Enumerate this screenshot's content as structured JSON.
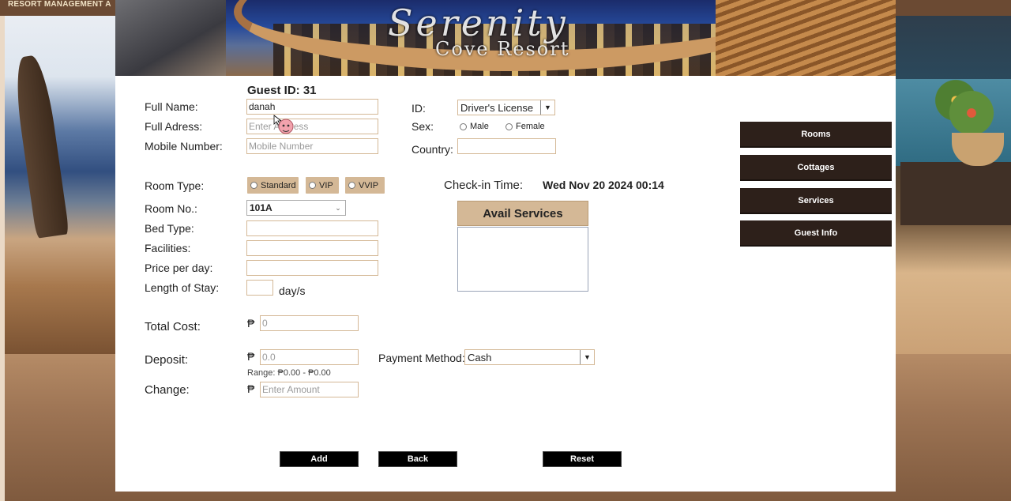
{
  "background": {
    "topbar_text": "RESORT MANAGEMENT    A"
  },
  "banner": {
    "logo_line1": "Serenity",
    "logo_line2": "Cove Resort"
  },
  "form": {
    "guest_id_label": "Guest ID: 31",
    "full_name_label": "Full Name:",
    "full_name_value": "danah",
    "full_address_label": "Full Adress:",
    "full_address_placeholder": "Enter Address",
    "mobile_label": "Mobile Number:",
    "mobile_placeholder": "Mobile Number",
    "id_label": "ID:",
    "id_select_value": "Driver's License",
    "sex_label": "Sex:",
    "sex_options": [
      "Male",
      "Female"
    ],
    "country_label": "Country:",
    "country_value": "",
    "room_type_label": "Room Type:",
    "room_type_options": [
      "Standard",
      "VIP",
      "VVIP"
    ],
    "checkin_label": "Check-in Time:",
    "checkin_value": "Wed Nov 20 2024 00:14",
    "room_no_label": "Room No.:",
    "room_no_value": "101A",
    "bed_type_label": "Bed Type:",
    "facilities_label": "Facilities:",
    "price_label": "Price per day:",
    "length_label": "Length of Stay:",
    "length_unit": "day/s",
    "total_cost_label": "Total Cost:",
    "currency_symbol": "₱",
    "total_cost_placeholder": "0",
    "deposit_label": "Deposit:",
    "deposit_placeholder": "0.0",
    "deposit_range": "Range: ₱0.00 - ₱0.00",
    "payment_label": "Payment Method:",
    "payment_value": "Cash",
    "change_label": "Change:",
    "change_placeholder": "Enter Amount",
    "avail_services_title": "Avail Services"
  },
  "buttons": {
    "add": "Add",
    "back": "Back",
    "reset": "Reset"
  },
  "sidebar": {
    "items": [
      {
        "label": "Rooms"
      },
      {
        "label": "Cottages"
      },
      {
        "label": "Services"
      },
      {
        "label": "Guest Info"
      }
    ]
  },
  "colors": {
    "accent_tan": "#d4b896",
    "sidebar_dark": "#2d201a",
    "button_black": "#000000"
  }
}
